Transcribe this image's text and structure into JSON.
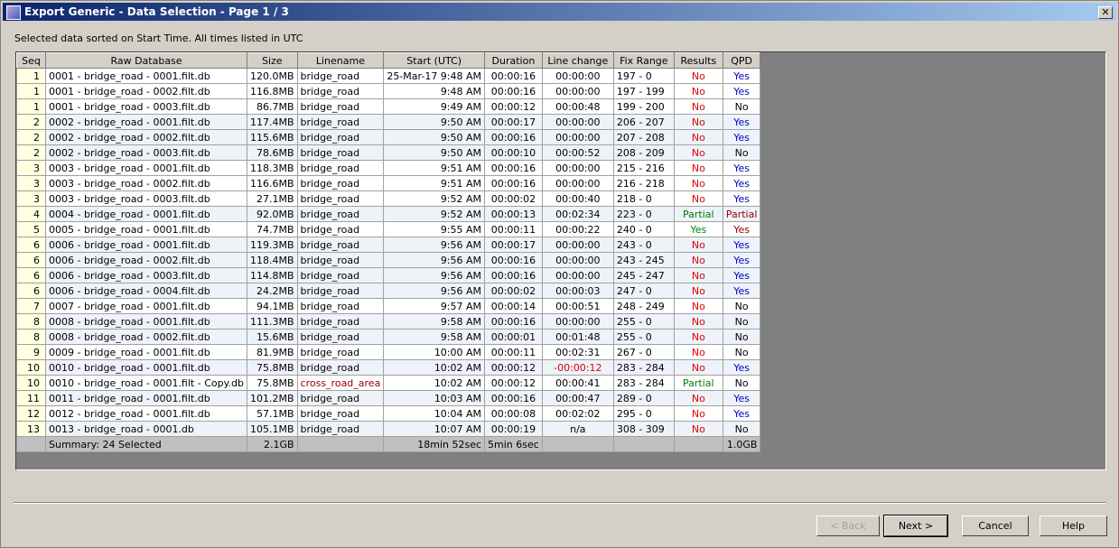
{
  "window": {
    "title": "Export Generic - Data Selection - Page 1 / 3",
    "close": "✕"
  },
  "info": "Selected data sorted on Start Time. All times listed in UTC",
  "columns": [
    "Seq",
    "Raw Database",
    "Size",
    "Linename",
    "Start (UTC)",
    "Duration",
    "Line change",
    "Fix Range",
    "Results",
    "QPD"
  ],
  "rows": [
    {
      "seq": "1",
      "db": "0001 - bridge_road - 0001.filt.db",
      "size": "120.0MB",
      "line": "bridge_road",
      "start": "25-Mar-17 9:48 AM",
      "dur": "00:00:16",
      "change": "00:00:00",
      "fix": "197 - 0",
      "results": "No",
      "qpd": "Yes"
    },
    {
      "seq": "1",
      "db": "0001 - bridge_road - 0002.filt.db",
      "size": "116.8MB",
      "line": "bridge_road",
      "start": "9:48 AM",
      "dur": "00:00:16",
      "change": "00:00:00",
      "fix": "197 - 199",
      "results": "No",
      "qpd": "Yes"
    },
    {
      "seq": "1",
      "db": "0001 - bridge_road - 0003.filt.db",
      "size": "86.7MB",
      "line": "bridge_road",
      "start": "9:49 AM",
      "dur": "00:00:12",
      "change": "00:00:48",
      "fix": "199 - 200",
      "results": "No",
      "qpd": "No"
    },
    {
      "seq": "2",
      "db": "0002 - bridge_road - 0001.filt.db",
      "size": "117.4MB",
      "line": "bridge_road",
      "start": "9:50 AM",
      "dur": "00:00:17",
      "change": "00:00:00",
      "fix": "206 - 207",
      "results": "No",
      "qpd": "Yes"
    },
    {
      "seq": "2",
      "db": "0002 - bridge_road - 0002.filt.db",
      "size": "115.6MB",
      "line": "bridge_road",
      "start": "9:50 AM",
      "dur": "00:00:16",
      "change": "00:00:00",
      "fix": "207 - 208",
      "results": "No",
      "qpd": "Yes"
    },
    {
      "seq": "2",
      "db": "0002 - bridge_road - 0003.filt.db",
      "size": "78.6MB",
      "line": "bridge_road",
      "start": "9:50 AM",
      "dur": "00:00:10",
      "change": "00:00:52",
      "fix": "208 - 209",
      "results": "No",
      "qpd": "No"
    },
    {
      "seq": "3",
      "db": "0003 - bridge_road - 0001.filt.db",
      "size": "118.3MB",
      "line": "bridge_road",
      "start": "9:51 AM",
      "dur": "00:00:16",
      "change": "00:00:00",
      "fix": "215 - 216",
      "results": "No",
      "qpd": "Yes"
    },
    {
      "seq": "3",
      "db": "0003 - bridge_road - 0002.filt.db",
      "size": "116.6MB",
      "line": "bridge_road",
      "start": "9:51 AM",
      "dur": "00:00:16",
      "change": "00:00:00",
      "fix": "216 - 218",
      "results": "No",
      "qpd": "Yes"
    },
    {
      "seq": "3",
      "db": "0003 - bridge_road - 0003.filt.db",
      "size": "27.1MB",
      "line": "bridge_road",
      "start": "9:52 AM",
      "dur": "00:00:02",
      "change": "00:00:40",
      "fix": "218 - 0",
      "results": "No",
      "qpd": "Yes"
    },
    {
      "seq": "4",
      "db": "0004 - bridge_road - 0001.filt.db",
      "size": "92.0MB",
      "line": "bridge_road",
      "start": "9:52 AM",
      "dur": "00:00:13",
      "change": "00:02:34",
      "fix": "223 - 0",
      "results": "Partial",
      "qpd": "Partial",
      "qpd_warn": true
    },
    {
      "seq": "5",
      "db": "0005 - bridge_road - 0001.filt.db",
      "size": "74.7MB",
      "line": "bridge_road",
      "start": "9:55 AM",
      "dur": "00:00:11",
      "change": "00:00:22",
      "fix": "240 - 0",
      "results": "Yes",
      "qpd": "Yes",
      "qpd_warn": true
    },
    {
      "seq": "6",
      "db": "0006 - bridge_road - 0001.filt.db",
      "size": "119.3MB",
      "line": "bridge_road",
      "start": "9:56 AM",
      "dur": "00:00:17",
      "change": "00:00:00",
      "fix": "243 - 0",
      "results": "No",
      "qpd": "Yes"
    },
    {
      "seq": "6",
      "db": "0006 - bridge_road - 0002.filt.db",
      "size": "118.4MB",
      "line": "bridge_road",
      "start": "9:56 AM",
      "dur": "00:00:16",
      "change": "00:00:00",
      "fix": "243 - 245",
      "results": "No",
      "qpd": "Yes"
    },
    {
      "seq": "6",
      "db": "0006 - bridge_road - 0003.filt.db",
      "size": "114.8MB",
      "line": "bridge_road",
      "start": "9:56 AM",
      "dur": "00:00:16",
      "change": "00:00:00",
      "fix": "245 - 247",
      "results": "No",
      "qpd": "Yes"
    },
    {
      "seq": "6",
      "db": "0006 - bridge_road - 0004.filt.db",
      "size": "24.2MB",
      "line": "bridge_road",
      "start": "9:56 AM",
      "dur": "00:00:02",
      "change": "00:00:03",
      "fix": "247 - 0",
      "results": "No",
      "qpd": "Yes"
    },
    {
      "seq": "7",
      "db": "0007 - bridge_road - 0001.filt.db",
      "size": "94.1MB",
      "line": "bridge_road",
      "start": "9:57 AM",
      "dur": "00:00:14",
      "change": "00:00:51",
      "fix": "248 - 249",
      "results": "No",
      "qpd": "No"
    },
    {
      "seq": "8",
      "db": "0008 - bridge_road - 0001.filt.db",
      "size": "111.3MB",
      "line": "bridge_road",
      "start": "9:58 AM",
      "dur": "00:00:16",
      "change": "00:00:00",
      "fix": "255 - 0",
      "results": "No",
      "qpd": "No"
    },
    {
      "seq": "8",
      "db": "0008 - bridge_road - 0002.filt.db",
      "size": "15.6MB",
      "line": "bridge_road",
      "start": "9:58 AM",
      "dur": "00:00:01",
      "change": "00:01:48",
      "fix": "255 - 0",
      "results": "No",
      "qpd": "No"
    },
    {
      "seq": "9",
      "db": "0009 - bridge_road - 0001.filt.db",
      "size": "81.9MB",
      "line": "bridge_road",
      "start": "10:00 AM",
      "dur": "00:00:11",
      "change": "00:02:31",
      "fix": "267 - 0",
      "results": "No",
      "qpd": "No"
    },
    {
      "seq": "10",
      "db": "0010 - bridge_road - 0001.filt.db",
      "size": "75.8MB",
      "line": "bridge_road",
      "start": "10:02 AM",
      "dur": "00:00:12",
      "change": "-00:00:12",
      "fix": "283 - 284",
      "results": "No",
      "qpd": "Yes"
    },
    {
      "seq": "10",
      "db": "0010 - bridge_road - 0001.filt - Copy.db",
      "size": "75.8MB",
      "line": "cross_road_area",
      "start": "10:02 AM",
      "dur": "00:00:12",
      "change": "00:00:41",
      "fix": "283 - 284",
      "results": "Partial",
      "qpd": "No"
    },
    {
      "seq": "11",
      "db": "0011 - bridge_road - 0001.filt.db",
      "size": "101.2MB",
      "line": "bridge_road",
      "start": "10:03 AM",
      "dur": "00:00:16",
      "change": "00:00:47",
      "fix": "289 - 0",
      "results": "No",
      "qpd": "Yes"
    },
    {
      "seq": "12",
      "db": "0012 - bridge_road - 0001.filt.db",
      "size": "57.1MB",
      "line": "bridge_road",
      "start": "10:04 AM",
      "dur": "00:00:08",
      "change": "00:02:02",
      "fix": "295 - 0",
      "results": "No",
      "qpd": "Yes"
    },
    {
      "seq": "13",
      "db": "0013 - bridge_road - 0001.db",
      "size": "105.1MB",
      "line": "bridge_road",
      "start": "10:07 AM",
      "dur": "00:00:19",
      "change": "n/a",
      "fix": "308 - 309",
      "results": "No",
      "qpd": "No"
    }
  ],
  "summary": {
    "label": "Summary:   24 Selected",
    "size": "2.1GB",
    "start": "18min 52sec",
    "dur": "5min 6sec",
    "qpd": "1.0GB"
  },
  "buttons": {
    "back": "< Back",
    "next": "Next >",
    "cancel": "Cancel",
    "help": "Help"
  }
}
